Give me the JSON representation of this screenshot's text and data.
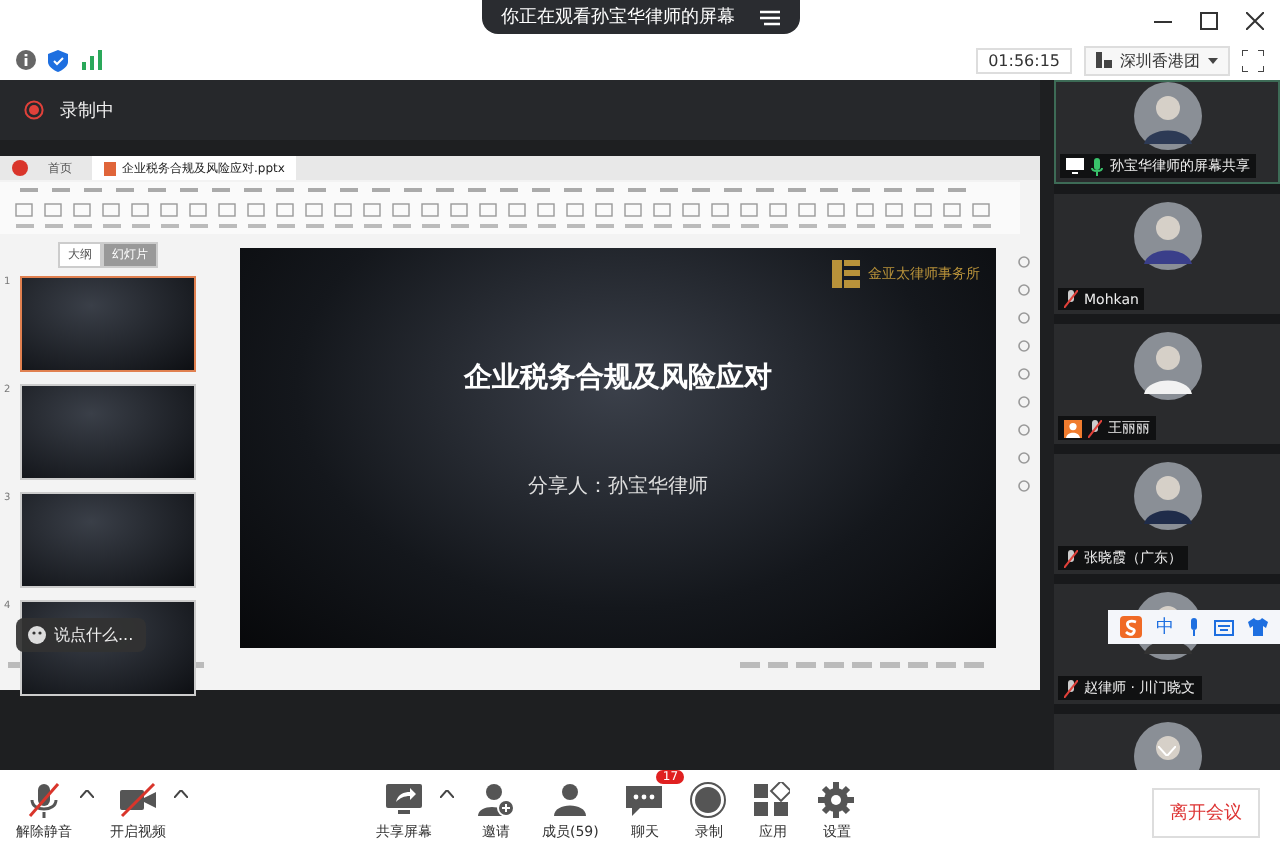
{
  "meeting_title": "你正在观看孙宝华律师的屏幕",
  "timer": "01:56:15",
  "layout_label": "深圳香港团",
  "recording": {
    "label": "录制中"
  },
  "shared_screen": {
    "tabs": [
      {
        "label": "首页",
        "selected": false
      },
      {
        "label": "企业税务合规及风险应对.pptx",
        "selected": true
      }
    ],
    "panel_tabs": [
      {
        "label": "大纲",
        "selected": false
      },
      {
        "label": "幻灯片",
        "selected": true
      }
    ],
    "thumbnails": [
      {
        "number": "1",
        "selected": true
      },
      {
        "number": "2",
        "selected": false
      },
      {
        "number": "3",
        "selected": false
      },
      {
        "number": "4",
        "selected": false
      }
    ],
    "slide": {
      "logo": "金亚太律师事务所",
      "title": "企业税务合规及风险应对",
      "presenter": "分享人：孙宝华律师"
    },
    "chat_placeholder": "说点什么..."
  },
  "participants": [
    {
      "name": "孙宝华律师的屏幕共享",
      "muted": false,
      "sharing": true,
      "host": false
    },
    {
      "name": "Mohkan",
      "muted": true,
      "sharing": false,
      "host": false
    },
    {
      "name": "王丽丽",
      "muted": true,
      "sharing": false,
      "host": true
    },
    {
      "name": "张晓霞（广东）",
      "muted": true,
      "sharing": false,
      "host": false
    },
    {
      "name": "赵律师 · 川门晓文",
      "muted": true,
      "sharing": false,
      "host": false
    }
  ],
  "ime_bar": {
    "label": "中"
  },
  "toolbar": [
    {
      "kind": "mic",
      "label": "解除静音",
      "caret": true
    },
    {
      "kind": "video",
      "label": "开启视频",
      "caret": true
    },
    {
      "kind": "share",
      "label": "共享屏幕",
      "caret": true
    },
    {
      "kind": "invite",
      "label": "邀请",
      "caret": false
    },
    {
      "kind": "members",
      "label": "成员(59)",
      "caret": false
    },
    {
      "kind": "chat",
      "label": "聊天",
      "caret": false,
      "badge": "17"
    },
    {
      "kind": "record",
      "label": "录制",
      "caret": false
    },
    {
      "kind": "apps",
      "label": "应用",
      "caret": false
    },
    {
      "kind": "settings",
      "label": "设置",
      "caret": false
    }
  ],
  "leave_button": "离开会议"
}
